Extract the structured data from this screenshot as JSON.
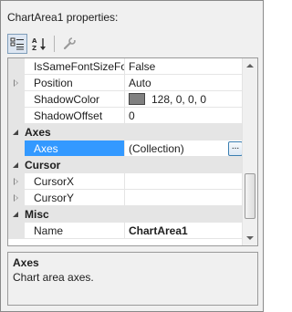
{
  "panel": {
    "title": "ChartArea1 properties:"
  },
  "toolbar": {
    "categorized_icon": "categorized-icon",
    "alphabetical_icon": "alphabetical-icon",
    "property_pages_icon": "wrench-icon"
  },
  "grid": {
    "rows": [
      {
        "kind": "prop",
        "name": "IsSameFontSizeFor...",
        "value": "False",
        "expander": "none"
      },
      {
        "kind": "prop",
        "name": "Position",
        "value": "Auto",
        "expander": "hollow"
      },
      {
        "kind": "prop",
        "name": "ShadowColor",
        "value": "128, 0, 0, 0",
        "expander": "none",
        "swatch": "#808080"
      },
      {
        "kind": "prop",
        "name": "ShadowOffset",
        "value": "0",
        "expander": "none"
      },
      {
        "kind": "cat",
        "name": "Axes"
      },
      {
        "kind": "prop",
        "name": "Axes",
        "value": "(Collection)",
        "expander": "none",
        "selected": true,
        "button": "..."
      },
      {
        "kind": "cat",
        "name": "Cursor"
      },
      {
        "kind": "prop",
        "name": "CursorX",
        "value": "",
        "expander": "hollow"
      },
      {
        "kind": "prop",
        "name": "CursorY",
        "value": "",
        "expander": "hollow"
      },
      {
        "kind": "cat",
        "name": "Misc"
      },
      {
        "kind": "prop",
        "name": "Name",
        "value": "ChartArea1",
        "expander": "none",
        "bold_value": true
      }
    ]
  },
  "scrollbar": {
    "position_fraction": 0.9
  },
  "description": {
    "title": "Axes",
    "text": "Chart area axes."
  },
  "colors": {
    "selection": "#3399ff",
    "category_bg": "#e5e5e5"
  }
}
